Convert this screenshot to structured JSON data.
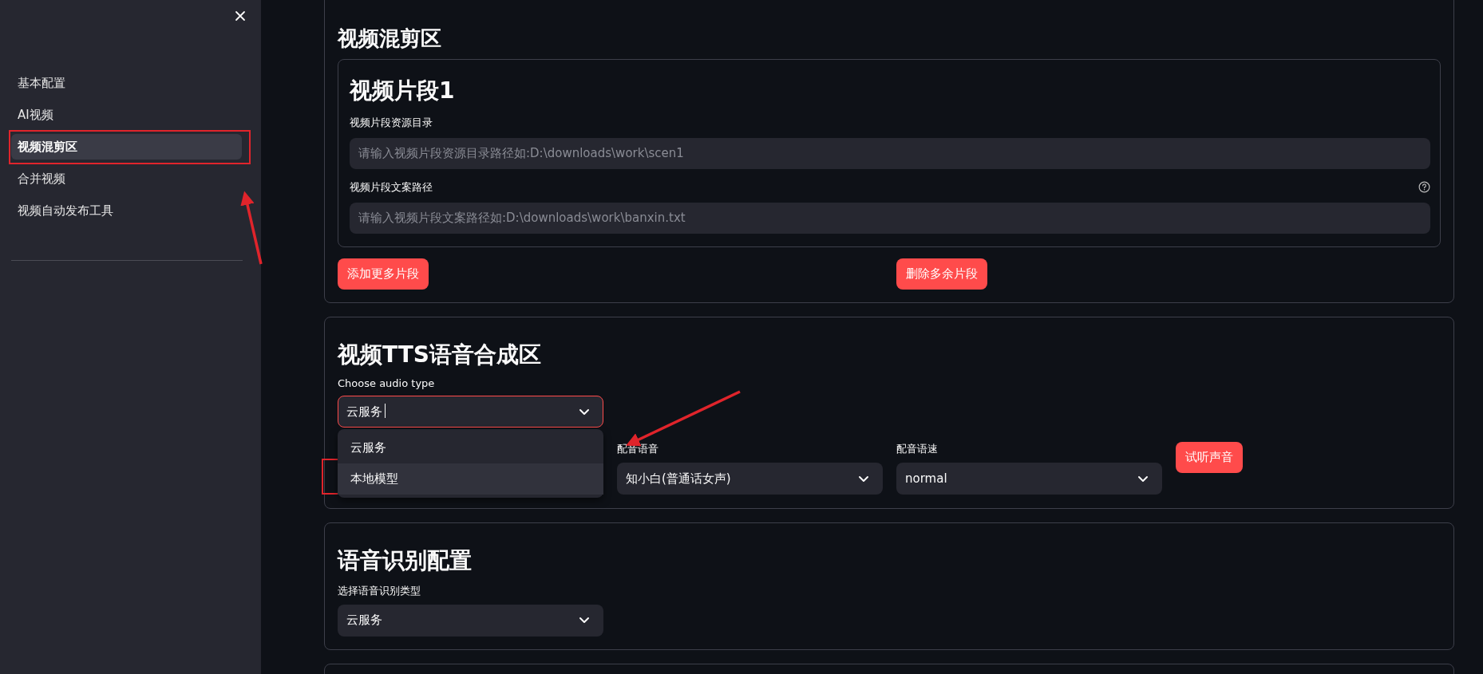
{
  "sidebar": {
    "items": [
      {
        "label": "基本配置",
        "selected": false
      },
      {
        "label": "AI视频",
        "selected": false
      },
      {
        "label": "视频混剪区",
        "selected": true
      },
      {
        "label": "合并视频",
        "selected": false
      },
      {
        "label": "视频自动发布工具",
        "selected": false
      }
    ]
  },
  "mix_section": {
    "title": "视频混剪区",
    "segments": [
      {
        "title": "视频片段1",
        "fields": [
          {
            "label": "视频片段资源目录",
            "placeholder": "请输入视频片段资源目录路径如:D:\\downloads\\work\\scen1",
            "help": false
          },
          {
            "label": "视频片段文案路径",
            "placeholder": "请输入视频片段文案路径如:D:\\downloads\\work\\banxin.txt",
            "help": true
          }
        ]
      }
    ],
    "buttons": [
      "添加更多片段",
      "删除多余片段"
    ]
  },
  "tts_section": {
    "title": "视频TTS语音合成区",
    "audio_type": {
      "label": "Choose audio type",
      "value": "云服务",
      "focused": true,
      "expanded": true,
      "options": [
        {
          "label": "云服务",
          "highlighted": false
        },
        {
          "label": "本地模型",
          "highlighted": true
        }
      ]
    },
    "voice": {
      "label": "配音语音",
      "value": "知小白(普通话女声)"
    },
    "speed": {
      "label": "配音语速",
      "value": "normal"
    },
    "preview_button": "试听声音"
  },
  "asr_section": {
    "title": "语音识别配置",
    "recognition_type": {
      "label": "选择语音识别类型",
      "value": "云服务"
    }
  }
}
